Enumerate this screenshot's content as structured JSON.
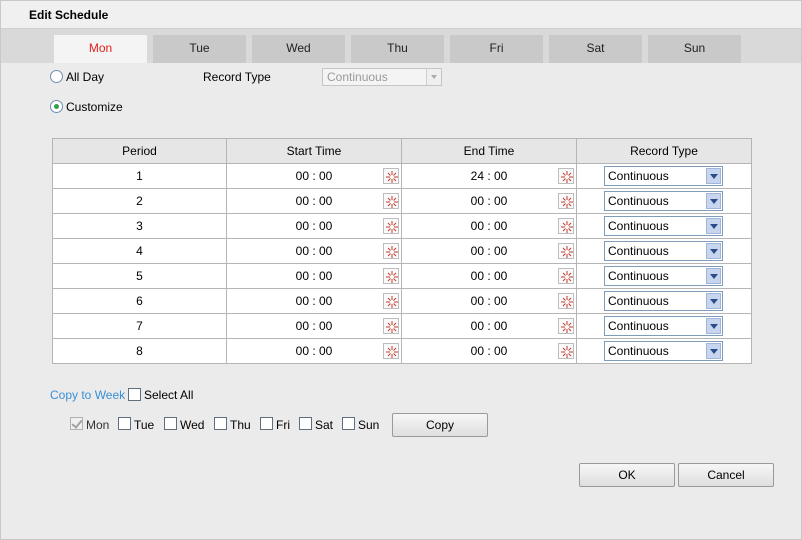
{
  "dialog": {
    "title": "Edit Schedule"
  },
  "tabs": [
    {
      "label": "Mon",
      "active": true
    },
    {
      "label": "Tue",
      "active": false
    },
    {
      "label": "Wed",
      "active": false
    },
    {
      "label": "Thu",
      "active": false
    },
    {
      "label": "Fri",
      "active": false
    },
    {
      "label": "Sat",
      "active": false
    },
    {
      "label": "Sun",
      "active": false
    }
  ],
  "mode": {
    "all_day_label": "All Day",
    "customize_label": "Customize",
    "selected": "Customize",
    "record_type_label": "Record Type",
    "record_type_value": "Continuous"
  },
  "table": {
    "headers": [
      "Period",
      "Start Time",
      "End Time",
      "Record Type"
    ],
    "rows": [
      {
        "period": "1",
        "start": "00 : 00",
        "end": "24 : 00",
        "type": "Continuous"
      },
      {
        "period": "2",
        "start": "00 : 00",
        "end": "00 : 00",
        "type": "Continuous"
      },
      {
        "period": "3",
        "start": "00 : 00",
        "end": "00 : 00",
        "type": "Continuous"
      },
      {
        "period": "4",
        "start": "00 : 00",
        "end": "00 : 00",
        "type": "Continuous"
      },
      {
        "period": "5",
        "start": "00 : 00",
        "end": "00 : 00",
        "type": "Continuous"
      },
      {
        "period": "6",
        "start": "00 : 00",
        "end": "00 : 00",
        "type": "Continuous"
      },
      {
        "period": "7",
        "start": "00 : 00",
        "end": "00 : 00",
        "type": "Continuous"
      },
      {
        "period": "8",
        "start": "00 : 00",
        "end": "00 : 00",
        "type": "Continuous"
      }
    ]
  },
  "copy": {
    "label": "Copy to Week",
    "select_all_label": "Select All",
    "days": [
      {
        "label": "Mon",
        "checked": true,
        "disabled": true
      },
      {
        "label": "Tue",
        "checked": false,
        "disabled": false
      },
      {
        "label": "Wed",
        "checked": false,
        "disabled": false
      },
      {
        "label": "Thu",
        "checked": false,
        "disabled": false
      },
      {
        "label": "Fri",
        "checked": false,
        "disabled": false
      },
      {
        "label": "Sat",
        "checked": false,
        "disabled": false
      },
      {
        "label": "Sun",
        "checked": false,
        "disabled": false
      }
    ],
    "copy_button": "Copy"
  },
  "footer": {
    "ok_label": "OK",
    "cancel_label": "Cancel"
  },
  "icons": {
    "time_picker": "clock-icon",
    "dropdown": "chevron-down-icon"
  },
  "colors": {
    "active_tab_text": "#e0201e",
    "copy_link": "#3a8fd6",
    "radio_checked": "#2ca24a"
  }
}
